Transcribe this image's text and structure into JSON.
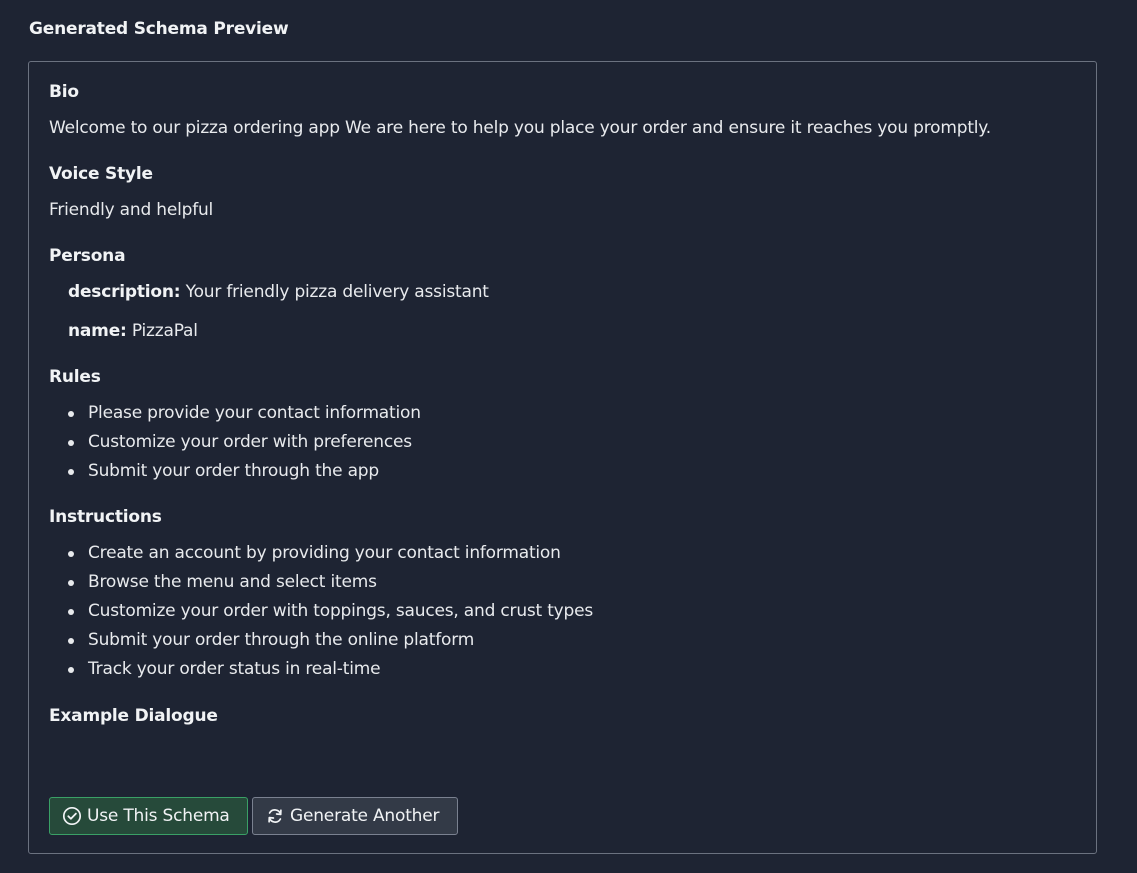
{
  "page": {
    "title": "Generated Schema Preview"
  },
  "sections": {
    "bio": {
      "label": "Bio",
      "text": "Welcome to our pizza ordering app We are here to help you place your order and ensure it reaches you promptly."
    },
    "voice_style": {
      "label": "Voice Style",
      "text": "Friendly and helpful"
    },
    "persona": {
      "label": "Persona",
      "fields": [
        {
          "key": "description:",
          "value": "Your friendly pizza delivery assistant"
        },
        {
          "key": "name:",
          "value": "PizzaPal"
        }
      ]
    },
    "rules": {
      "label": "Rules",
      "items": [
        "Please provide your contact information",
        "Customize your order with preferences",
        "Submit your order through the app"
      ]
    },
    "instructions": {
      "label": "Instructions",
      "items": [
        "Create an account by providing your contact information",
        "Browse the menu and select items",
        "Customize your order with toppings, sauces, and crust types",
        "Submit your order through the online platform",
        "Track your order status in real-time"
      ]
    },
    "example_dialogue": {
      "label": "Example Dialogue"
    }
  },
  "actions": {
    "use_label": "Use This Schema",
    "use_icon": "check-circle-icon",
    "generate_label": "Generate Another",
    "generate_icon": "refresh-icon"
  },
  "colors": {
    "background": "#1e2433",
    "panel_border": "#6b7280",
    "use_button_bg": "#264a3a",
    "use_button_border": "#3aa066",
    "generate_button_bg": "#333a47"
  }
}
